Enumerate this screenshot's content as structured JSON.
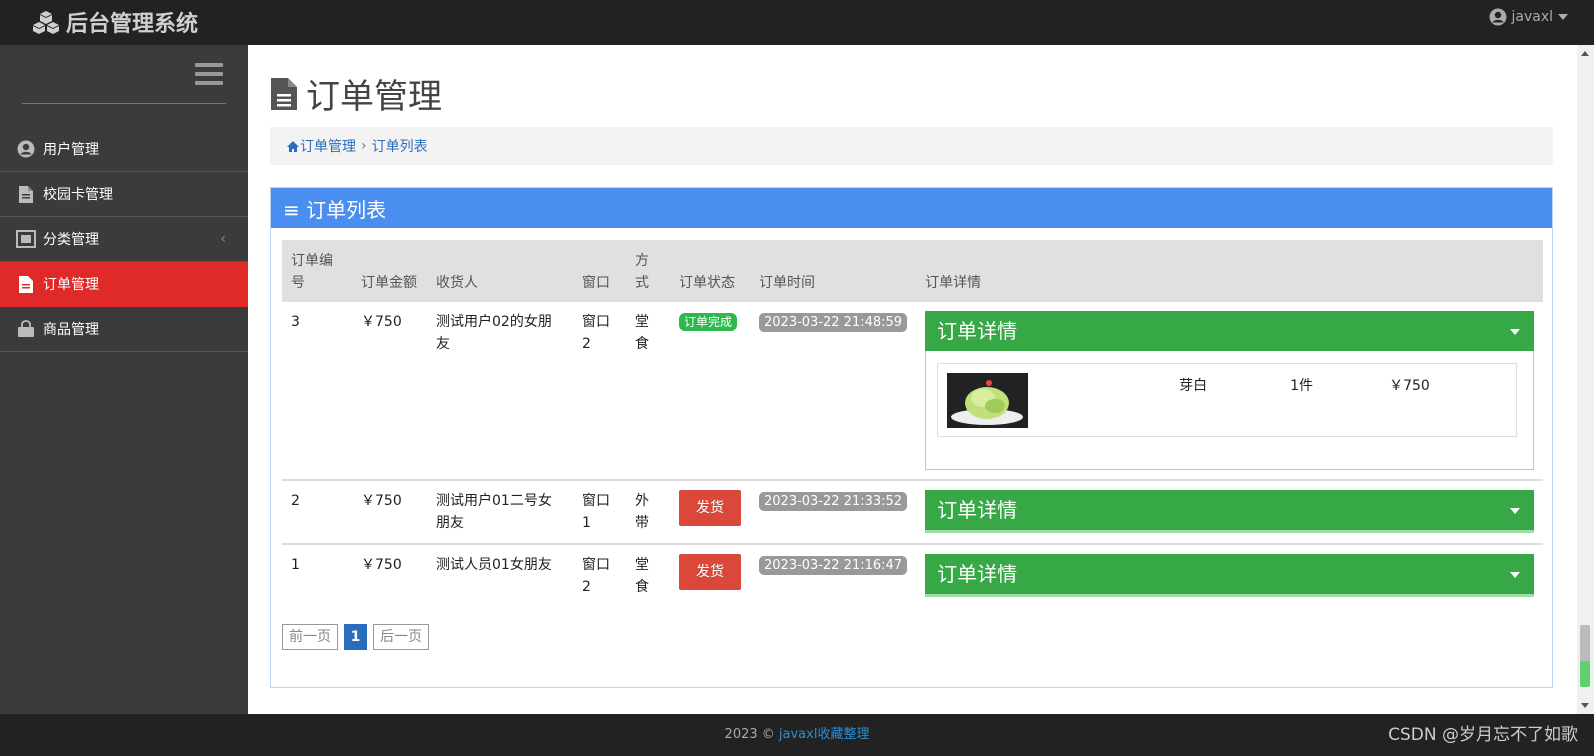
{
  "app": {
    "title": "后台管理系统"
  },
  "user": {
    "name": "javaxl"
  },
  "sidebar": {
    "items": [
      {
        "label": "用户管理",
        "icon": "user-circle-icon",
        "active": false
      },
      {
        "label": "校园卡管理",
        "icon": "file-icon",
        "active": false
      },
      {
        "label": "分类管理",
        "icon": "expand-icon",
        "active": false,
        "has_submenu": true
      },
      {
        "label": "订单管理",
        "icon": "file-text-icon",
        "active": true
      },
      {
        "label": "商品管理",
        "icon": "shopping-bag-icon",
        "active": false
      }
    ]
  },
  "page": {
    "title": "订单管理"
  },
  "breadcrumb": {
    "home": "订单管理",
    "separator": "›",
    "current": "订单列表"
  },
  "panel": {
    "title": "≡ 订单列表"
  },
  "table": {
    "headers": [
      "订单编号",
      "订单金额",
      "收货人",
      "窗口",
      "方式",
      "订单状态",
      "订单时间",
      "订单详情"
    ],
    "rows": [
      {
        "id": "3",
        "amount": "￥750",
        "receiver": "测试用户02的女朋友",
        "window": "窗口2",
        "method": "堂食",
        "status": "订单完成",
        "status_type": "done",
        "time": "2023-03-22 21:48:59",
        "detail_title": "订单详情",
        "expanded": true,
        "items": [
          {
            "name": "芽白",
            "qty": "1件",
            "price": "￥750"
          }
        ]
      },
      {
        "id": "2",
        "amount": "￥750",
        "receiver": "测试用户01二号女朋友",
        "window": "窗口1",
        "method": "外带",
        "status": "发货",
        "status_type": "ship",
        "time": "2023-03-22 21:33:52",
        "detail_title": "订单详情",
        "expanded": false
      },
      {
        "id": "1",
        "amount": "￥750",
        "receiver": "测试人员01女朋友",
        "window": "窗口2",
        "method": "堂食",
        "status": "发货",
        "status_type": "ship",
        "time": "2023-03-22 21:16:47",
        "detail_title": "订单详情",
        "expanded": false
      }
    ]
  },
  "pager": {
    "prev": "前一页",
    "current": "1",
    "next": "后一页"
  },
  "footer": {
    "prefix": "2023 © ",
    "link": "javaxl收藏整理"
  },
  "watermark": "CSDN @岁月忘不了如歌",
  "colors": {
    "primary": "#4a8ef0",
    "success": "#36a845",
    "danger": "#d9483b",
    "active_menu": "#e02a2a"
  }
}
